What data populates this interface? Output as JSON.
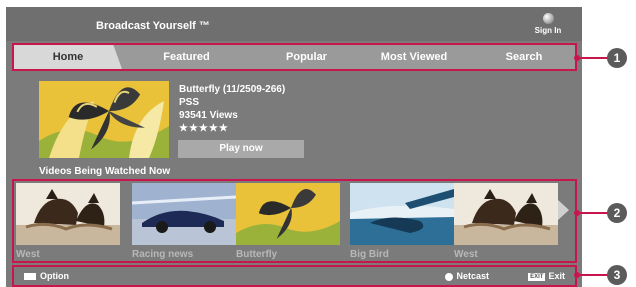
{
  "header": {
    "brand": "Broadcast Yourself ™",
    "signin_label": "Sign In"
  },
  "nav": {
    "tabs": [
      {
        "label": "Home",
        "selected": true
      },
      {
        "label": "Featured"
      },
      {
        "label": "Popular"
      },
      {
        "label": "Most Viewed"
      },
      {
        "label": "Search"
      }
    ]
  },
  "featured": {
    "title": "Butterfly (11/2509-266)",
    "author": "PSS",
    "views": "93541 Views",
    "rating": "★★★★★",
    "play_label": "Play now"
  },
  "watched": {
    "title": "Videos Being Watched Now",
    "items": [
      {
        "caption": "West",
        "kind": "west"
      },
      {
        "caption": "Racing news",
        "kind": "racing"
      },
      {
        "caption": "Butterfly",
        "kind": "butterfly"
      },
      {
        "caption": "Big Bird",
        "kind": "bigbird"
      },
      {
        "caption": "West",
        "kind": "west"
      }
    ]
  },
  "footer": {
    "option_label": "Option",
    "netcast_label": "Netcast",
    "exit_key": "EXIT",
    "exit_label": "Exit"
  },
  "callouts": [
    "1",
    "2",
    "3"
  ],
  "colors": {
    "screen_bg": "#7b7b7b",
    "highlight_border": "#c9154e",
    "callout_bg": "#5b5b5b"
  }
}
